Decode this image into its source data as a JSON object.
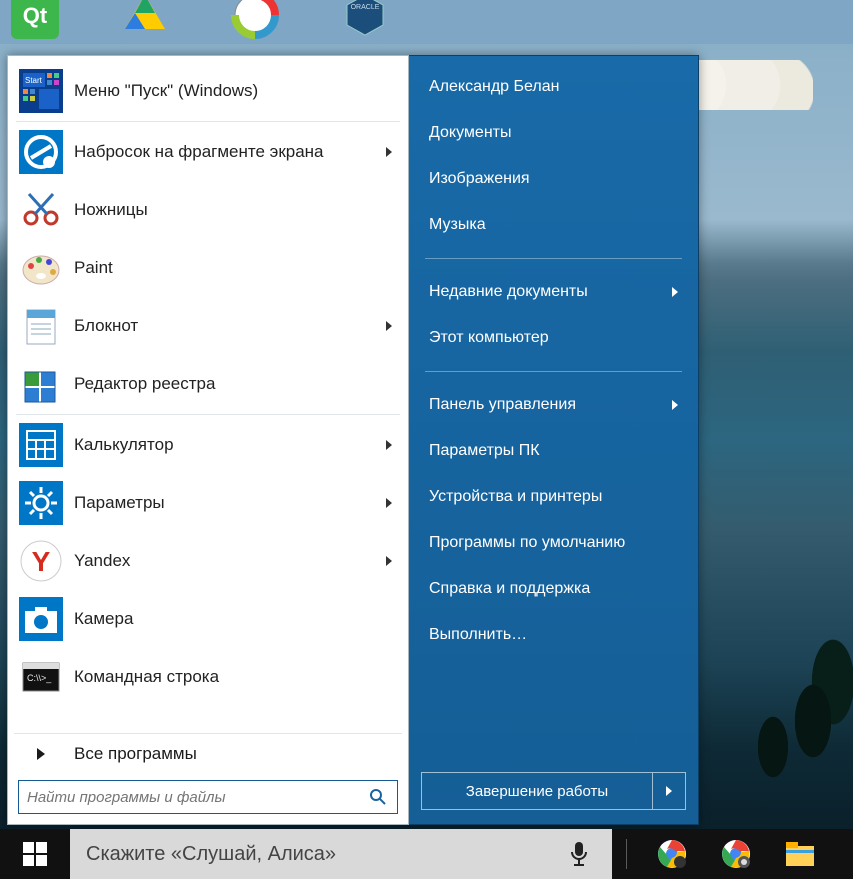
{
  "left_panel": {
    "items": [
      {
        "label": "Меню \"Пуск\" (Windows)",
        "icon": "start-tile-icon",
        "arrow": false
      },
      {
        "label": "Набросок на фрагменте экрана",
        "icon": "snip-sketch-icon",
        "arrow": true
      },
      {
        "label": "Ножницы",
        "icon": "scissors-icon",
        "arrow": false
      },
      {
        "label": "Paint",
        "icon": "paint-icon",
        "arrow": false
      },
      {
        "label": "Блокнот",
        "icon": "notepad-icon",
        "arrow": true
      },
      {
        "label": "Редактор реестра",
        "icon": "regedit-icon",
        "arrow": false
      },
      {
        "label": "Калькулятор",
        "icon": "calculator-icon",
        "arrow": true
      },
      {
        "label": "Параметры",
        "icon": "settings-gear-icon",
        "arrow": true
      },
      {
        "label": "Yandex",
        "icon": "yandex-icon",
        "arrow": true
      },
      {
        "label": "Камера",
        "icon": "camera-icon",
        "arrow": false
      },
      {
        "label": "Командная строка",
        "icon": "cmd-icon",
        "arrow": false
      }
    ],
    "all_programs": "Все программы",
    "search_placeholder": "Найти программы и файлы"
  },
  "right_panel": {
    "user": "Александр Белан",
    "section1": [
      {
        "label": "Документы",
        "arrow": false
      },
      {
        "label": "Изображения",
        "arrow": false
      },
      {
        "label": "Музыка",
        "arrow": false
      }
    ],
    "section2": [
      {
        "label": "Недавние документы",
        "arrow": true
      },
      {
        "label": "Этот компьютер",
        "arrow": false
      }
    ],
    "section3": [
      {
        "label": "Панель управления",
        "arrow": true
      },
      {
        "label": "Параметры ПК",
        "arrow": false
      },
      {
        "label": "Устройства и принтеры",
        "arrow": false
      },
      {
        "label": "Программы по умолчанию",
        "arrow": false
      },
      {
        "label": "Справка и поддержка",
        "arrow": false
      },
      {
        "label": "Выполнить…",
        "arrow": false
      }
    ],
    "shutdown": "Завершение работы"
  },
  "taskbar": {
    "cortana_placeholder": "Скажите «Слушай, Алиса»"
  }
}
